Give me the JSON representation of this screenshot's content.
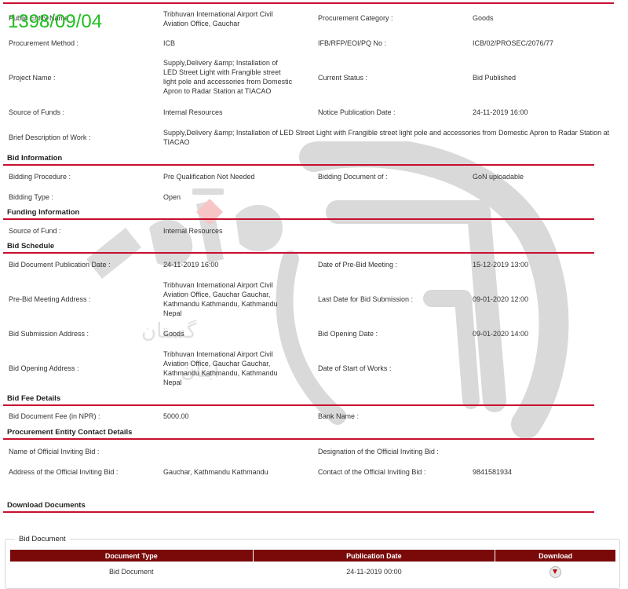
{
  "date_stamp": "1398/09/04",
  "fields": {
    "public_entity_name": {
      "label": "Public Entity Name :",
      "value": "Tribhuvan International Airport Civil Aviation Office, Gauchar"
    },
    "procurement_category": {
      "label": "Procurement Category :",
      "value": "Goods"
    },
    "procurement_method": {
      "label": "Procurement Method :",
      "value": "ICB"
    },
    "ifb_no": {
      "label": "IFB/RFP/EOI/PQ No :",
      "value": "ICB/02/PROSEC/2076/77"
    },
    "project_name": {
      "label": "Project Name :",
      "value": "Supply,Delivery &amp; Installation of LED Street Light with Frangible street light pole and accessories from Domestic Apron to Radar Station at TIACAO"
    },
    "current_status": {
      "label": "Current Status :",
      "value": "Bid Published"
    },
    "source_of_funds": {
      "label": "Source of Funds :",
      "value": "Internal Resources"
    },
    "notice_publication_date": {
      "label": "Notice Publication Date :",
      "value": "24-11-2019 16:00"
    },
    "brief_description": {
      "label": "Brief Description of Work :",
      "value": "Supply,Delivery &amp; Installation of LED Street Light with Frangible street light pole and accessories from Domestic Apron to Radar Station at TIACAO"
    }
  },
  "bid_information": {
    "title": "Bid Information",
    "bidding_procedure": {
      "label": "Bidding Procedure :",
      "value": "Pre Qualification Not Needed"
    },
    "bidding_document_of": {
      "label": "Bidding Document of :",
      "value": "GoN uploadable"
    },
    "bidding_type": {
      "label": "Bidding Type :",
      "value": "Open"
    }
  },
  "funding_information": {
    "title": "Funding Information",
    "source_of_fund": {
      "label": "Source of Fund :",
      "value": "Internal Resources"
    }
  },
  "bid_schedule": {
    "title": "Bid Schedule",
    "bid_doc_publication_date": {
      "label": "Bid Document Publication Date :",
      "value": "24-11-2019 16:00"
    },
    "pre_bid_meeting_date": {
      "label": "Date of Pre-Bid Meeting :",
      "value": "15-12-2019 13:00"
    },
    "pre_bid_meeting_address": {
      "label": "Pre-Bid Meeting Address :",
      "value": "Tribhuvan International Airport Civil Aviation Office, Gauchar Gauchar, Kathmandu Kathmandu, Kathmandu Nepal"
    },
    "last_date_submission": {
      "label": "Last Date for Bid Submission :",
      "value": "09-01-2020 12:00"
    },
    "bid_submission_address": {
      "label": "Bid Submission Address :",
      "value": "Goods"
    },
    "bid_opening_date": {
      "label": "Bid Opening Date :",
      "value": "09-01-2020 14:00"
    },
    "bid_opening_address": {
      "label": "Bid Opening Address :",
      "value": "Tribhuvan International Airport Civil Aviation Office, Gauchar Gauchar, Kathmandu Kathmandu, Kathmandu Nepal"
    },
    "date_start_works": {
      "label": "Date of Start of Works :",
      "value": ""
    }
  },
  "bid_fee": {
    "title": "Bid Fee Details",
    "bid_document_fee": {
      "label": "Bid Document Fee (in NPR) :",
      "value": "5000.00"
    },
    "bank_name": {
      "label": "Bank Name :",
      "value": ""
    }
  },
  "contact": {
    "title": "Procurement Entity Contact Details",
    "official_name": {
      "label": "Name of Official Inviting Bid :",
      "value": ""
    },
    "official_designation": {
      "label": "Designation of the Official Inviting Bid :",
      "value": ""
    },
    "official_address": {
      "label": "Address of the Official Inviting Bid :",
      "value": "Gauchar, Kathmandu Kathmandu"
    },
    "official_contact": {
      "label": "Contact of the Official Inviting Bid :",
      "value": "9841581934"
    }
  },
  "download_documents": {
    "title": "Download Documents"
  },
  "bid_document_panel": {
    "legend": "Bid Document",
    "columns": [
      "Document Type",
      "Publication Date",
      "Download"
    ],
    "rows": [
      {
        "document_type": "Bid Document",
        "publication_date": "24-11-2019 00:00",
        "download_icon": "download-icon"
      }
    ]
  },
  "colors": {
    "accent": "#c8102e",
    "table_header": "#7a0a0a",
    "stamp": "#1fbf1f"
  }
}
